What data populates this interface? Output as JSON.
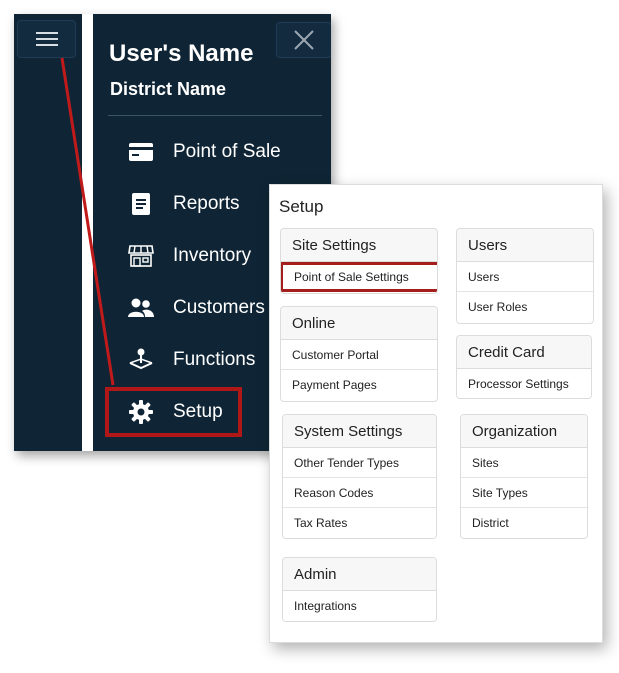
{
  "nav": {
    "user_name": "User's Name",
    "district_name": "District Name",
    "items": [
      {
        "label": "Point of Sale",
        "icon": "credit-card-icon"
      },
      {
        "label": "Reports",
        "icon": "document-icon"
      },
      {
        "label": "Inventory",
        "icon": "store-icon"
      },
      {
        "label": "Customers",
        "icon": "users-icon"
      },
      {
        "label": "Functions",
        "icon": "joystick-icon"
      },
      {
        "label": "Setup",
        "icon": "gear-icon",
        "active": true
      }
    ],
    "colors": {
      "background": "#0f2535",
      "highlight": "#b01818"
    }
  },
  "setup": {
    "title": "Setup",
    "groups": {
      "site_settings": {
        "title": "Site Settings",
        "items": [
          "Point of Sale Settings"
        ]
      },
      "users": {
        "title": "Users",
        "items": [
          "Users",
          "User Roles"
        ]
      },
      "online": {
        "title": "Online",
        "items": [
          "Customer Portal",
          "Payment Pages"
        ]
      },
      "credit_card": {
        "title": "Credit Card",
        "items": [
          "Processor Settings"
        ]
      },
      "system_settings": {
        "title": "System Settings",
        "items": [
          "Other Tender Types",
          "Reason Codes",
          "Tax Rates"
        ]
      },
      "organization": {
        "title": "Organization",
        "items": [
          "Sites",
          "Site Types",
          "District"
        ]
      },
      "admin": {
        "title": "Admin",
        "items": [
          "Integrations"
        ]
      }
    }
  }
}
